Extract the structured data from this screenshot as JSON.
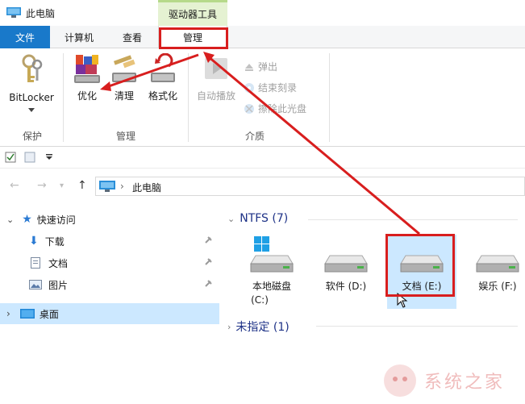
{
  "window": {
    "title": "此电脑",
    "context_title": "驱动器工具"
  },
  "tabs": {
    "file": "文件",
    "computer": "计算机",
    "view": "查看",
    "manage": "管理"
  },
  "ribbon": {
    "bitlocker": "BitLocker",
    "optimize": "优化",
    "cleanup": "清理",
    "format": "格式化",
    "autoplay": "自动播放",
    "eject": "弹出",
    "finish_burn": "结束刻录",
    "erase_disc": "擦除此光盘",
    "group_protect": "保护",
    "group_manage": "管理",
    "group_media": "介质"
  },
  "address": {
    "crumb": "此电脑"
  },
  "nav": {
    "quick_access": "快速访问",
    "downloads": "下载",
    "documents": "文档",
    "pictures": "图片",
    "desktop": "桌面"
  },
  "content": {
    "ntfs_header": "NTFS (7)",
    "unspecified_header": "未指定 (1)",
    "drives": [
      {
        "name": "本地磁盘",
        "letter": "(C:)"
      },
      {
        "name": "软件 (D:)",
        "letter": ""
      },
      {
        "name": "文档 (E:)",
        "letter": ""
      },
      {
        "name": "娱乐 (F:)",
        "letter": ""
      }
    ]
  },
  "watermark": "系统之家",
  "colors": {
    "accent": "#1979ca",
    "annotation": "#d81e1e",
    "selection": "#cce8ff"
  }
}
